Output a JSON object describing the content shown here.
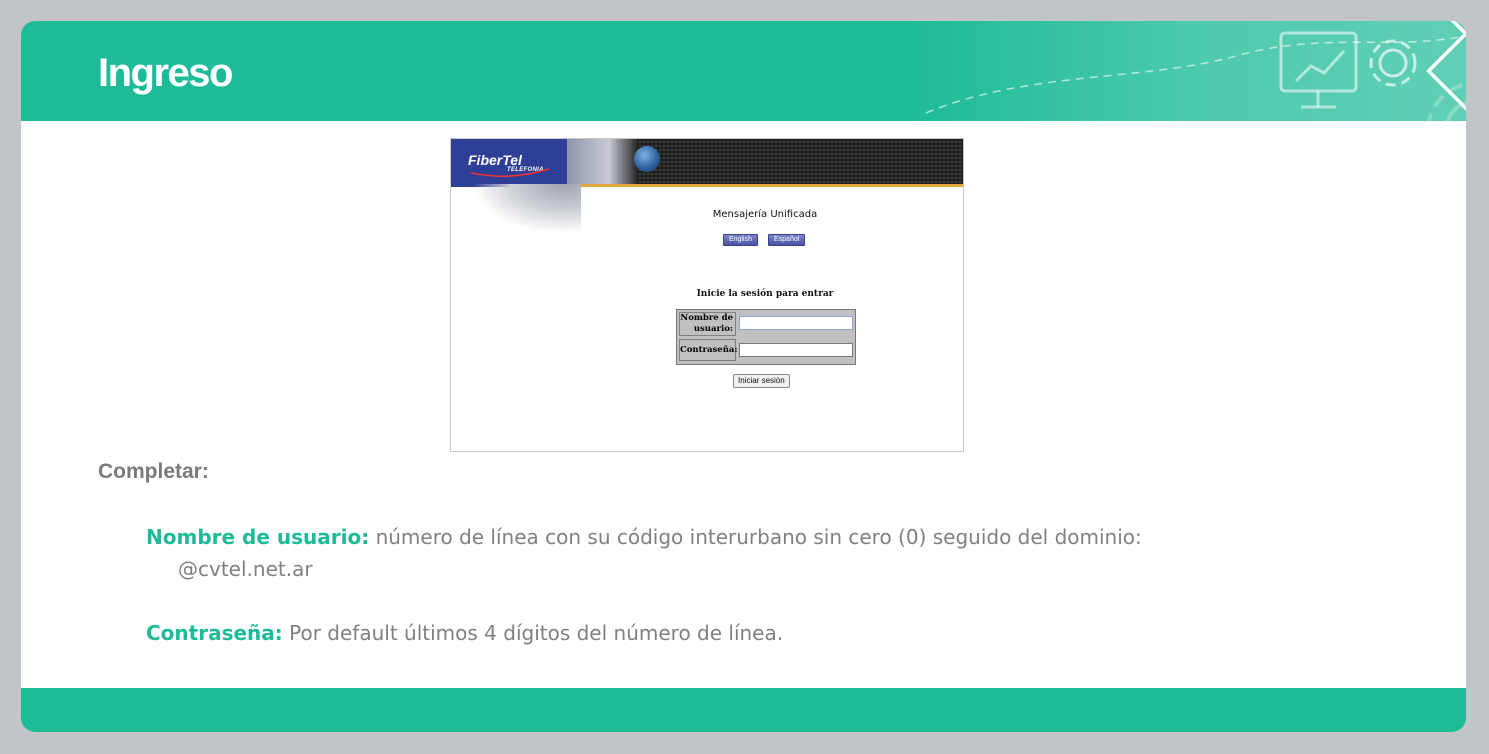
{
  "header": {
    "title": "Ingreso"
  },
  "screenshot": {
    "logo": {
      "brand": "FiberTel",
      "sub": "TELEFONIA"
    },
    "title": "Mensajería Unificada",
    "languages": [
      "English",
      "Español"
    ],
    "subtitle": "Inicie la sesión para entrar",
    "form": {
      "username_label": "Nombre de usuario:",
      "username_value": "",
      "password_label": "Contraseña:",
      "password_value": ""
    },
    "submit_label": "Iniciar sesión"
  },
  "content": {
    "heading": "Completar:",
    "items": [
      {
        "key": "Nombre de usuario:",
        "text": "número de línea con su código interurbano sin cero (0) seguido del dominio:",
        "continuation": "@cvtel.net.ar"
      },
      {
        "key": "Contraseña:",
        "text": "Por default últimos 4 dígitos del número de línea."
      }
    ]
  },
  "colors": {
    "brand": "#1dbb98",
    "text": "#808080",
    "background": "#c2c5c8"
  },
  "icons": [
    "presentation-icon",
    "gear-icon",
    "pencil-puzzle-icon",
    "mouse-icon"
  ]
}
